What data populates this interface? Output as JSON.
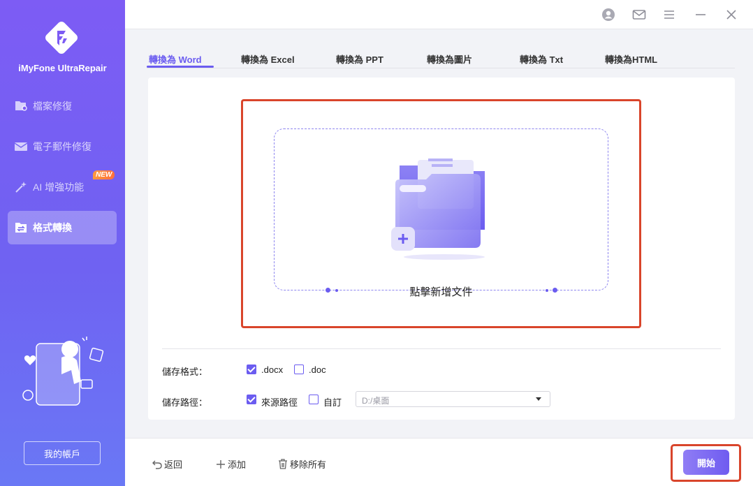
{
  "app": {
    "name": "iMyFone UltraRepair"
  },
  "sidebar": {
    "items": [
      {
        "label": "檔案修復",
        "icon": "file-repair-icon"
      },
      {
        "label": "電子郵件修復",
        "icon": "mail-icon"
      },
      {
        "label": "AI 增強功能",
        "icon": "ai-sparkle-icon",
        "badge": "NEW"
      },
      {
        "label": "格式轉換",
        "icon": "convert-icon",
        "active": true
      }
    ],
    "account_label": "我的帳戶"
  },
  "titlebar": {
    "icons": [
      "user-icon",
      "mail-icon",
      "menu-icon",
      "minimize-icon",
      "close-icon"
    ]
  },
  "tabs": [
    {
      "label": "轉換為 Word",
      "active": true
    },
    {
      "label": "轉換為 Excel"
    },
    {
      "label": "轉換為 PPT"
    },
    {
      "label": "轉換為圖片"
    },
    {
      "label": "轉換為 Txt"
    },
    {
      "label": "轉換為HTML"
    }
  ],
  "dropzone": {
    "label": "點擊新增文件",
    "icon": "add-folder-icon"
  },
  "options": {
    "format_label": "儲存格式：",
    "format_options": [
      {
        "label": ".docx",
        "checked": true
      },
      {
        "label": ".doc",
        "checked": false
      }
    ],
    "path_label": "儲存路徑：",
    "path_options": [
      {
        "label": "來源路徑",
        "checked": true
      },
      {
        "label": "自訂",
        "checked": false
      }
    ],
    "path_value": "D:/桌面"
  },
  "footer": {
    "back_label": "返回",
    "add_label": "添加",
    "remove_all_label": "移除所有",
    "start_label": "開始"
  },
  "colors": {
    "accent": "#6b5cf0",
    "highlight": "#d9452b",
    "badge": "#ff7a3c"
  }
}
